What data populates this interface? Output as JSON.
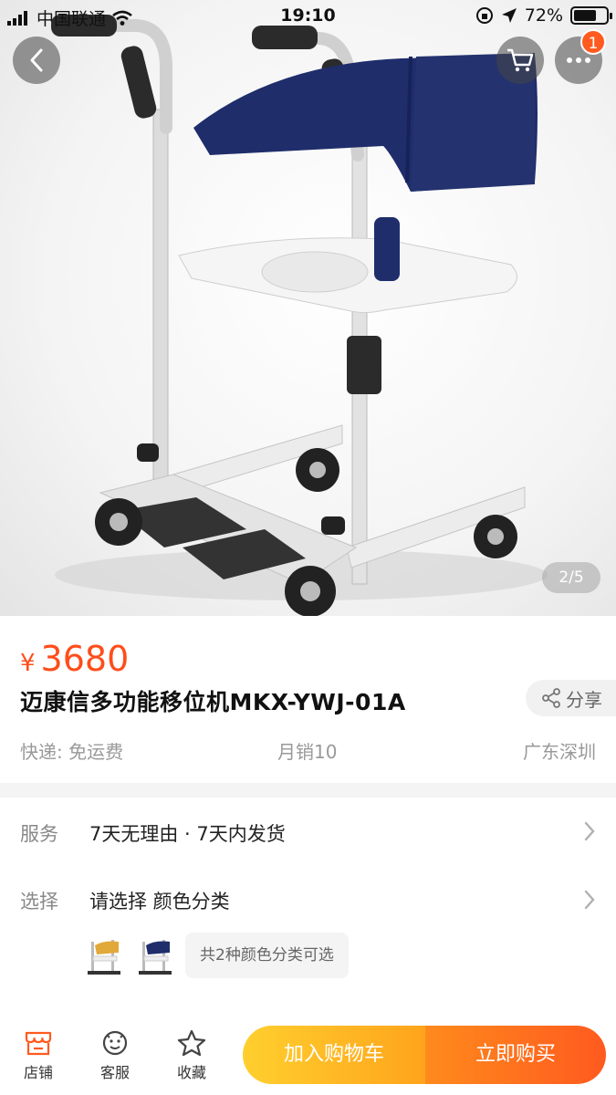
{
  "status_bar": {
    "carrier": "中国联通",
    "time": "19:10",
    "battery": "72%",
    "battery_level": 0.72
  },
  "nav": {
    "back_icon": "chevron-left-icon",
    "cart_icon": "cart-icon",
    "more_icon": "more-dots-icon",
    "more_badge": "1"
  },
  "gallery": {
    "indicator": "2/5",
    "product_image": "patient-transfer-chair"
  },
  "product": {
    "currency": "¥",
    "price": "3680",
    "title": "迈康信多功能移位机MKX-YWJ-01A",
    "share_label": "分享",
    "shipping": "快递: 免运费",
    "monthly_sales": "月销10",
    "location": "广东深圳"
  },
  "service_row": {
    "label": "服务",
    "value": "7天无理由 · 7天内发货"
  },
  "select_row": {
    "label": "选择",
    "value": "请选择 颜色分类",
    "variants": [
      "yellow-chair-thumb",
      "blue-chair-thumb"
    ],
    "variant_note": "共2种颜色分类可选"
  },
  "bottom_bar": {
    "shop_label": "店铺",
    "service_label": "客服",
    "favorite_label": "收藏",
    "add_to_cart": "加入购物车",
    "buy_now": "立即购买"
  },
  "colors": {
    "accent": "#ff4d1a",
    "cart_gradient": [
      "#ffcf2e",
      "#ffa41c"
    ],
    "buy_gradient": [
      "#ff8a1c",
      "#ff5a1f"
    ],
    "seat_navy": "#1f2d6b"
  }
}
